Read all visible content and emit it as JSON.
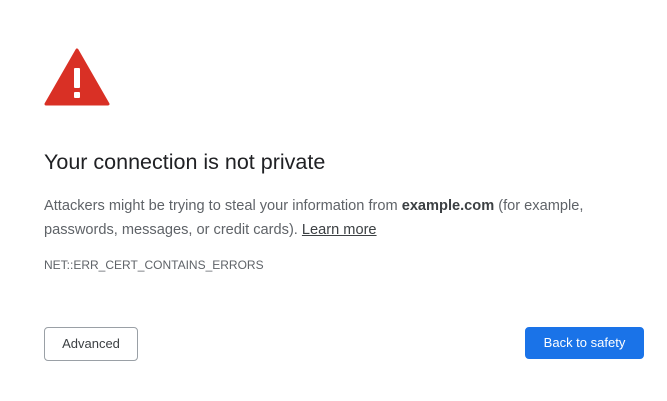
{
  "interstitial": {
    "icon": "warning-triangle-icon",
    "icon_color": "#d93025",
    "title": "Your connection is not private",
    "message": {
      "before_domain": "Attackers might be trying to steal your information from ",
      "domain": "example.com",
      "after_domain": " (for example, passwords, messages, or credit cards). ",
      "learn_more": "Learn more"
    },
    "error_code": "NET::ERR_CERT_CONTAINS_ERRORS",
    "advanced_label": "Advanced",
    "back_to_safety_label": "Back to safety",
    "primary_color": "#1a73e8"
  }
}
